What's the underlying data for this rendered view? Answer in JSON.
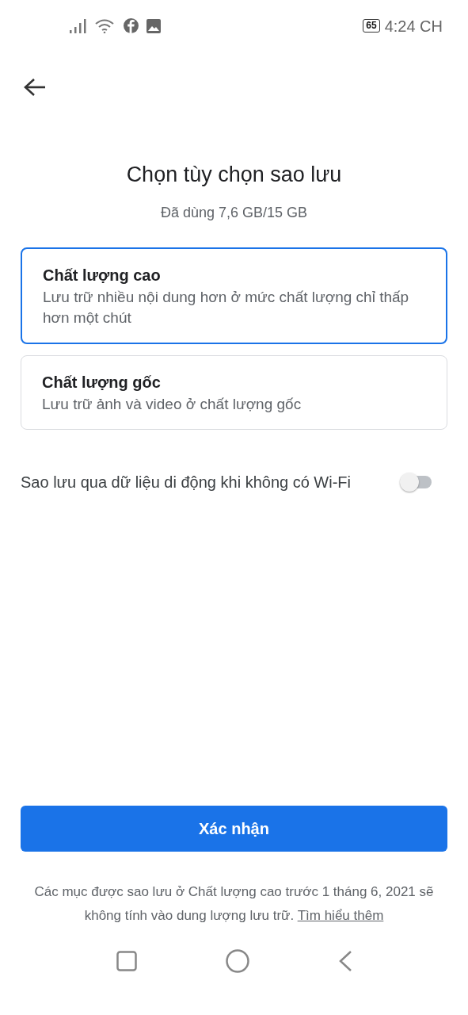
{
  "status_bar": {
    "battery": "65",
    "time": "4:24 CH"
  },
  "title": "Chọn tùy chọn sao lưu",
  "subtitle": "Đã dùng 7,6 GB/15 GB",
  "options": [
    {
      "title": "Chất lượng cao",
      "description": "Lưu trữ nhiều nội dung hơn ở mức chất lượng chỉ thấp hơn một chút",
      "selected": true
    },
    {
      "title": "Chất lượng gốc",
      "description": "Lưu trữ ảnh và video ở chất lượng gốc",
      "selected": false
    }
  ],
  "mobile_data_setting": {
    "label": "Sao lưu qua dữ liệu di động khi không có Wi-Fi",
    "on": false
  },
  "confirm_button": "Xác nhận",
  "footer": {
    "text": "Các mục được sao lưu ở Chất lượng cao trước 1 tháng 6, 2021 sẽ không tính vào dung lượng lưu trữ.",
    "link": "Tìm hiểu thêm"
  }
}
